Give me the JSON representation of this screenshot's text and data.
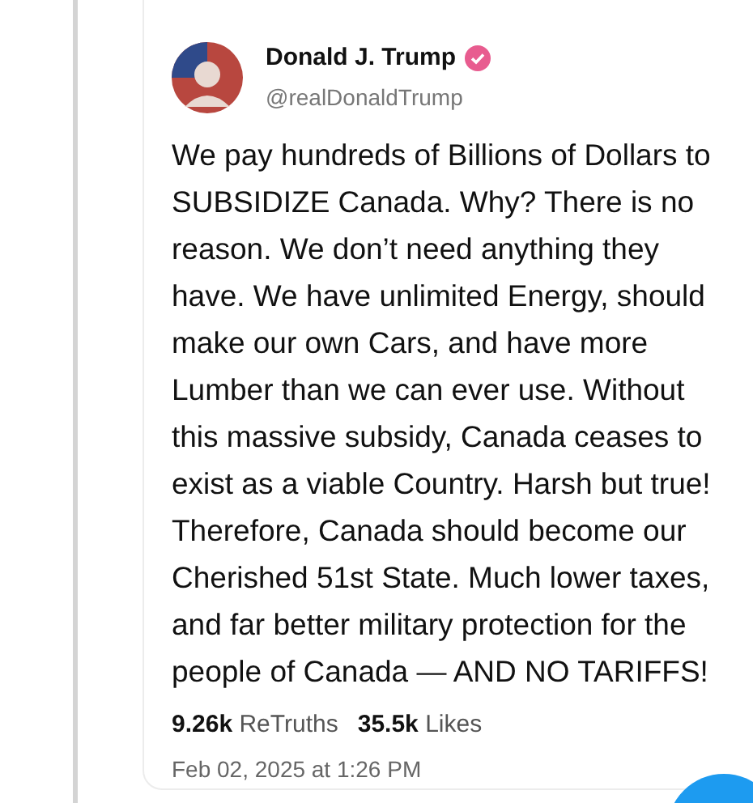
{
  "post": {
    "author": "Donald J. Trump",
    "verified": true,
    "handle": "@realDonaldTrump",
    "body_lines": [
      "We pay hundreds of Billions of Dollars to",
      "SUBSIDIZE Canada. Why? There is no",
      "reason. We don’t need anything they",
      "have. We have unlimited Energy, should",
      "make our own Cars, and have more",
      "Lumber than we can ever use. Without",
      "this massive subsidy, Canada ceases to",
      "exist as a viable Country. Harsh but true!",
      "Therefore, Canada should become our",
      "Cherished 51st State. Much lower taxes,",
      "and far better military protection for the",
      "people of Canada — AND NO TARIFFS!"
    ],
    "stats": [
      {
        "count": "9.26k",
        "label": "ReTruths"
      },
      {
        "count": "35.5k",
        "label": "Likes"
      }
    ],
    "timestamp": "Feb 02, 2025 at 1:26 PM"
  }
}
